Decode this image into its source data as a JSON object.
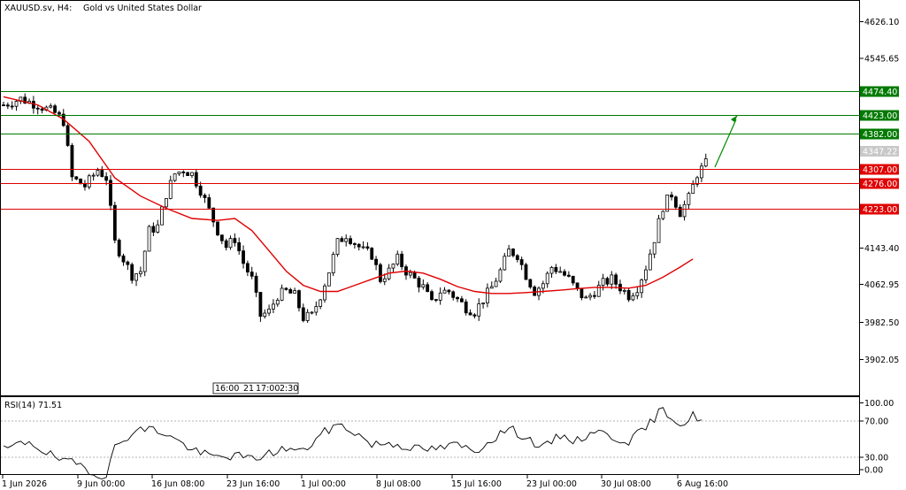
{
  "header": {
    "symbol": "XAUUSD.sv, H4:",
    "description": "Gold vs United States Dollar"
  },
  "rsi": {
    "label": "RSI(14) 71.51",
    "levels": [
      "100.00",
      "70.00",
      "30.00",
      "0.00"
    ]
  },
  "colors": {
    "support": "#e00000",
    "resistance": "#007a00",
    "moving_average": "#e00000",
    "candle": "#000000",
    "current_price_bg": "#c8c8c8",
    "arrow": "#008a00"
  },
  "chart_data": {
    "type": "line",
    "symbol": "XAUUSD.sv",
    "timeframe": "H4",
    "title": "Gold vs United States Dollar",
    "y_ticks": [
      "4626.10",
      "4545.65",
      "4143.40",
      "4062.95",
      "3982.50",
      "3902.05"
    ],
    "y_tick_values": [
      4626.1,
      4545.65,
      4143.4,
      4062.95,
      3982.5,
      3902.05
    ],
    "x_ticks": [
      "1 Jun 2026",
      "9 Jun 00:00",
      "16 Jun 08:00",
      "23 Jun 16:00",
      "1 Jul 00:00",
      "8 Jul 08:00",
      "15 Jul 16:00",
      "23 Jul 00:00",
      "30 Jul 08:00",
      "6 Aug 16:00"
    ],
    "session_labels": [
      "16:00",
      "21",
      "17:00",
      "2:30"
    ],
    "current_price": "4347.22",
    "horizontal_levels": [
      {
        "label": "4474.40",
        "value": 4474.4,
        "kind": "resistance"
      },
      {
        "label": "4423.00",
        "value": 4423.0,
        "kind": "resistance"
      },
      {
        "label": "4382.00",
        "value": 4382.0,
        "kind": "resistance"
      },
      {
        "label": "4307.00",
        "value": 4307.0,
        "kind": "support"
      },
      {
        "label": "4276.00",
        "value": 4276.0,
        "kind": "support"
      },
      {
        "label": "4223.00",
        "value": 4223.0,
        "kind": "support"
      }
    ],
    "price_keypoints": [
      [
        0,
        4510
      ],
      [
        4,
        4525
      ],
      [
        8,
        4510
      ],
      [
        12,
        4490
      ],
      [
        14,
        4470
      ],
      [
        16,
        4330
      ],
      [
        19,
        4310
      ],
      [
        22,
        4350
      ],
      [
        24,
        4330
      ],
      [
        26,
        4170
      ],
      [
        28,
        4130
      ],
      [
        30,
        4090
      ],
      [
        32,
        4100
      ],
      [
        34,
        4200
      ],
      [
        36,
        4210
      ],
      [
        38,
        4290
      ],
      [
        40,
        4340
      ],
      [
        42,
        4350
      ],
      [
        44,
        4340
      ],
      [
        46,
        4300
      ],
      [
        48,
        4250
      ],
      [
        50,
        4200
      ],
      [
        52,
        4160
      ],
      [
        54,
        4180
      ],
      [
        56,
        4120
      ],
      [
        58,
        4080
      ],
      [
        60,
        3990
      ],
      [
        62,
        4000
      ],
      [
        64,
        4040
      ],
      [
        66,
        4050
      ],
      [
        68,
        4040
      ],
      [
        70,
        3985
      ],
      [
        72,
        3990
      ],
      [
        74,
        4040
      ],
      [
        76,
        4100
      ],
      [
        78,
        4170
      ],
      [
        80,
        4190
      ],
      [
        82,
        4170
      ],
      [
        84,
        4150
      ],
      [
        86,
        4140
      ],
      [
        88,
        4080
      ],
      [
        90,
        4100
      ],
      [
        92,
        4130
      ],
      [
        94,
        4100
      ],
      [
        96,
        4080
      ],
      [
        98,
        4060
      ],
      [
        100,
        4020
      ],
      [
        102,
        4050
      ],
      [
        104,
        4050
      ],
      [
        106,
        4030
      ],
      [
        108,
        4010
      ],
      [
        110,
        4000
      ],
      [
        112,
        4030
      ],
      [
        114,
        4060
      ],
      [
        116,
        4100
      ],
      [
        118,
        4150
      ],
      [
        120,
        4140
      ],
      [
        122,
        4090
      ],
      [
        124,
        4050
      ],
      [
        126,
        4070
      ],
      [
        128,
        4110
      ],
      [
        130,
        4100
      ],
      [
        132,
        4080
      ],
      [
        134,
        4050
      ],
      [
        136,
        4030
      ],
      [
        138,
        4050
      ],
      [
        140,
        4070
      ],
      [
        142,
        4080
      ],
      [
        144,
        4060
      ],
      [
        146,
        4040
      ],
      [
        148,
        4060
      ],
      [
        150,
        4110
      ],
      [
        152,
        4180
      ],
      [
        154,
        4260
      ],
      [
        156,
        4290
      ],
      [
        158,
        4245
      ],
      [
        160,
        4280
      ],
      [
        162,
        4340
      ],
      [
        164,
        4365
      ]
    ],
    "moving_average": [
      [
        0,
        4530
      ],
      [
        8,
        4510
      ],
      [
        14,
        4475
      ],
      [
        20,
        4420
      ],
      [
        26,
        4330
      ],
      [
        32,
        4285
      ],
      [
        38,
        4255
      ],
      [
        44,
        4230
      ],
      [
        50,
        4225
      ],
      [
        54,
        4230
      ],
      [
        58,
        4200
      ],
      [
        62,
        4150
      ],
      [
        66,
        4100
      ],
      [
        70,
        4065
      ],
      [
        74,
        4050
      ],
      [
        78,
        4050
      ],
      [
        82,
        4065
      ],
      [
        86,
        4080
      ],
      [
        90,
        4095
      ],
      [
        94,
        4100
      ],
      [
        98,
        4095
      ],
      [
        102,
        4080
      ],
      [
        106,
        4062
      ],
      [
        110,
        4050
      ],
      [
        114,
        4045
      ],
      [
        118,
        4045
      ],
      [
        122,
        4047
      ],
      [
        126,
        4050
      ],
      [
        130,
        4053
      ],
      [
        134,
        4057
      ],
      [
        138,
        4060
      ],
      [
        142,
        4060
      ],
      [
        146,
        4058
      ],
      [
        150,
        4065
      ],
      [
        154,
        4085
      ],
      [
        158,
        4110
      ],
      [
        161,
        4130
      ]
    ],
    "rsi_keypoints": [
      [
        0,
        38
      ],
      [
        6,
        48
      ],
      [
        10,
        35
      ],
      [
        14,
        25
      ],
      [
        18,
        22
      ],
      [
        22,
        10
      ],
      [
        24,
        12
      ],
      [
        26,
        40
      ],
      [
        30,
        58
      ],
      [
        34,
        62
      ],
      [
        38,
        56
      ],
      [
        42,
        44
      ],
      [
        46,
        34
      ],
      [
        50,
        30
      ],
      [
        54,
        32
      ],
      [
        58,
        28
      ],
      [
        62,
        34
      ],
      [
        66,
        40
      ],
      [
        70,
        36
      ],
      [
        74,
        55
      ],
      [
        78,
        66
      ],
      [
        82,
        58
      ],
      [
        86,
        44
      ],
      [
        90,
        46
      ],
      [
        94,
        42
      ],
      [
        98,
        38
      ],
      [
        102,
        40
      ],
      [
        106,
        44
      ],
      [
        110,
        36
      ],
      [
        114,
        50
      ],
      [
        118,
        62
      ],
      [
        122,
        52
      ],
      [
        126,
        40
      ],
      [
        130,
        54
      ],
      [
        134,
        48
      ],
      [
        138,
        60
      ],
      [
        142,
        52
      ],
      [
        146,
        48
      ],
      [
        150,
        62
      ],
      [
        154,
        84
      ],
      [
        157,
        70
      ],
      [
        159,
        66
      ],
      [
        161,
        76
      ],
      [
        163,
        72
      ]
    ],
    "x_range": [
      0,
      171
    ],
    "ylim": [
      3860,
      4660
    ],
    "rsi_ylim": [
      0,
      100
    ]
  }
}
